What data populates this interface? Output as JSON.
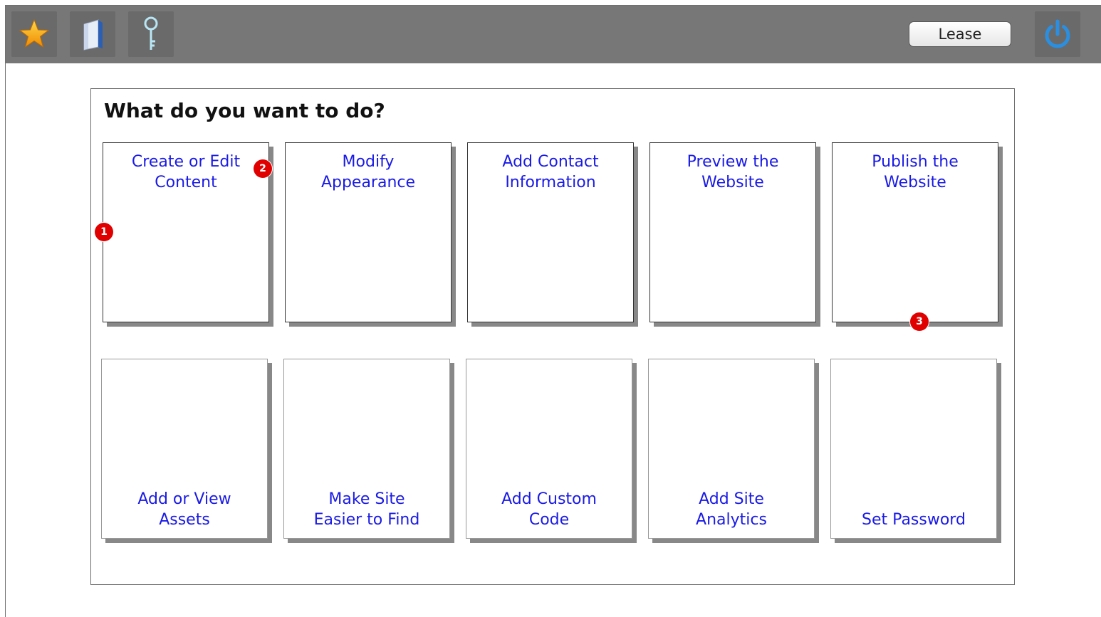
{
  "toolbar": {
    "buttons": [
      {
        "icon": "star-icon"
      },
      {
        "icon": "book-icon"
      },
      {
        "icon": "key-icon"
      }
    ],
    "lease_label": "Lease",
    "power_icon": "power-icon"
  },
  "panel": {
    "title": "What do you want to do?",
    "tiles_row1": [
      "Create or Edit\nContent",
      "Modify\nAppearance",
      "Add Contact\nInformation",
      "Preview the\nWebsite",
      "Publish the\nWebsite"
    ],
    "tiles_row2": [
      "Add or View\nAssets",
      "Make Site\nEasier to Find",
      "Add Custom\nCode",
      "Add Site\nAnalytics",
      "Set Password"
    ]
  },
  "markers": [
    "1",
    "2",
    "3"
  ],
  "colors": {
    "toolbar": "#777777",
    "link": "#1a1ae6",
    "marker": "#e00000",
    "power": "#2a8fe0"
  }
}
